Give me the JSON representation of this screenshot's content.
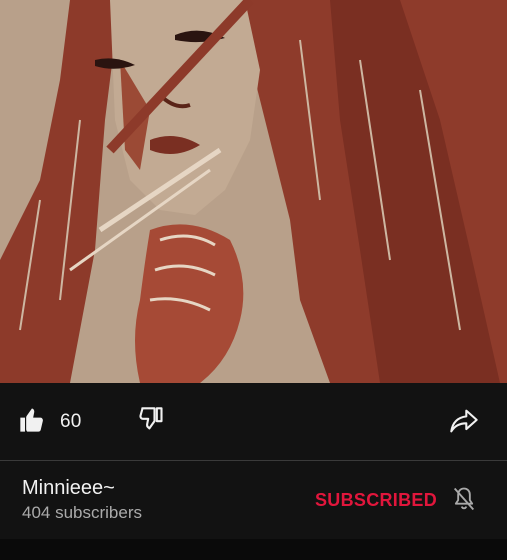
{
  "video": {
    "thumbnail": "stylized portrait illustration in rust-red and beige tones"
  },
  "actions": {
    "like_icon": "thumbs-up-icon",
    "like_count": "60",
    "dislike_icon": "thumbs-down-icon",
    "share_icon": "share-arrow-icon"
  },
  "channel": {
    "name": "Minnieee~",
    "subscribers": "404 subscribers",
    "subscribe_state": "SUBSCRIBED",
    "notification_icon": "bell-off-icon"
  },
  "colors": {
    "background": "#0f0f0f",
    "subscribed_accent": "#e1163c",
    "text_primary": "#f1f1f1",
    "text_secondary": "#aaaaaa"
  }
}
